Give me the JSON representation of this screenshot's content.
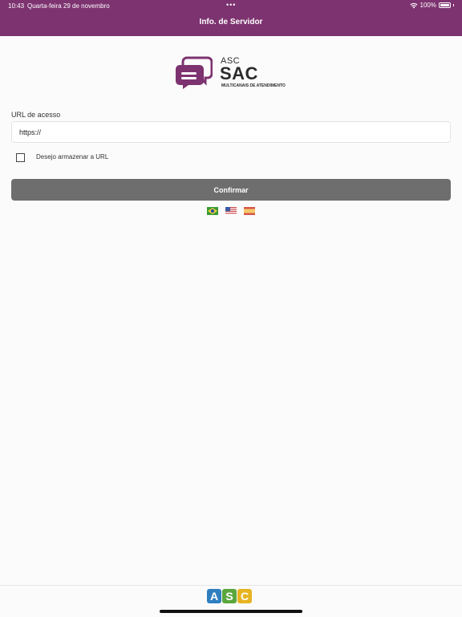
{
  "status_bar": {
    "time": "10:43",
    "date": "Quarta-feira 29 de novembro",
    "dots": "•••",
    "battery": "100%"
  },
  "header": {
    "title": "Info. de Servidor"
  },
  "logo": {
    "small": "ASC",
    "big": "SAC",
    "tagline": "MULTICANAIS DE ATENDIMENTO"
  },
  "form": {
    "url_label": "URL de acesso",
    "url_value": "https://",
    "store_url_label": "Desejo armazenar a URL",
    "store_url_checked": false,
    "confirm_label": "Confirmar"
  },
  "languages": [
    "flag-brazil-icon",
    "flag-usa-icon",
    "flag-spain-icon"
  ],
  "footer": {
    "brand_letters": [
      "A",
      "S",
      "C"
    ],
    "brand_colors": [
      "#2f7fbf",
      "#5aa63c",
      "#e6b420"
    ]
  },
  "colors": {
    "header": "#7d3370",
    "logo_bubble": "#7d3370",
    "button": "#6e6e6e"
  }
}
